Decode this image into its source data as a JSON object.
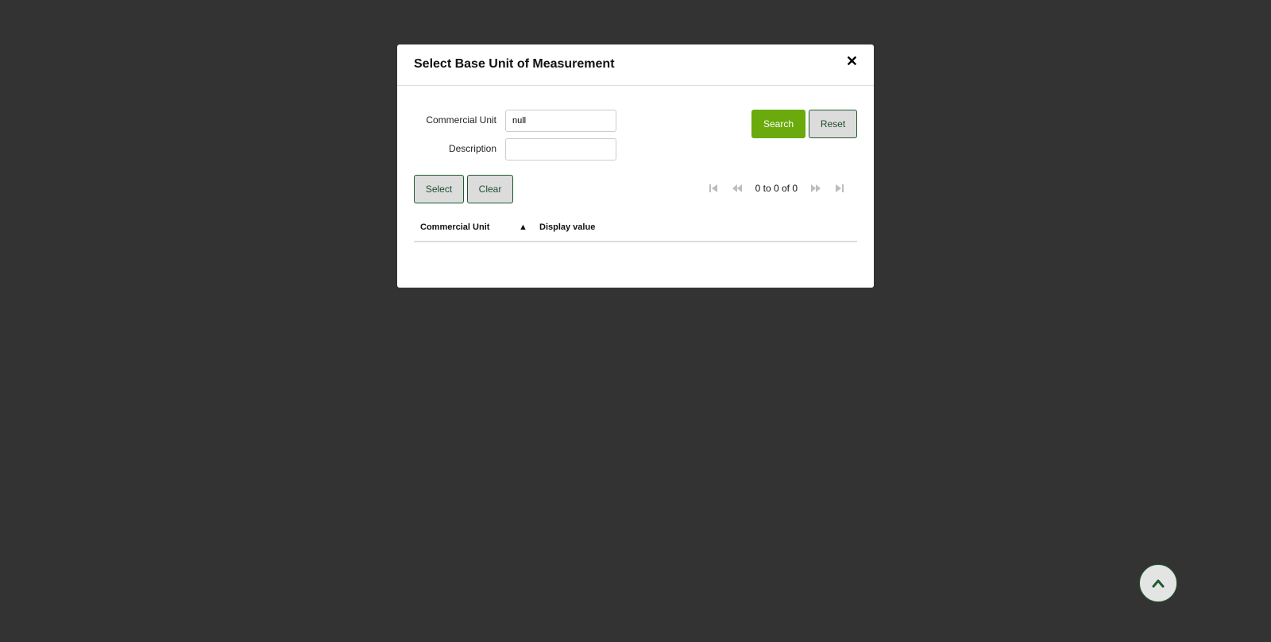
{
  "modal": {
    "title": "Select Base Unit of Measurement",
    "close_icon": "close-icon"
  },
  "form": {
    "commercial_unit_label": "Commercial Unit",
    "commercial_unit_value": "null",
    "description_label": "Description",
    "description_value": ""
  },
  "actions": {
    "search_label": "Search",
    "reset_label": "Reset",
    "select_label": "Select",
    "clear_label": "Clear"
  },
  "pager": {
    "text": "0 to 0 of 0",
    "icons": [
      "first-page-icon",
      "previous-page-icon",
      "next-page-icon",
      "last-page-icon"
    ]
  },
  "table": {
    "columns": [
      "Commercial Unit",
      "Display value"
    ],
    "sort_indicator": "▲",
    "rows": []
  },
  "scroll_top": {
    "icon": "chevron-up-icon"
  },
  "colors": {
    "backdrop": "#333333",
    "primary": "#6aaa0c",
    "secondary_border": "#1e5a2e"
  }
}
